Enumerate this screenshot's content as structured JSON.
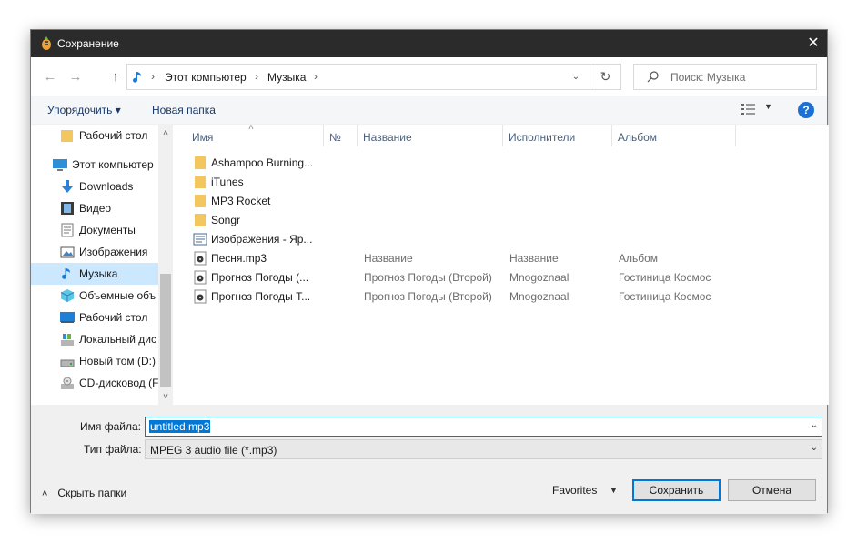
{
  "window": {
    "title": "Сохранение",
    "close_glyph": "✕"
  },
  "address": {
    "back_glyph": "←",
    "forward_glyph": "→",
    "up_glyph": "↑",
    "crumbs": [
      "Этот компьютер",
      "Музыка"
    ],
    "sep_glyph": "›",
    "dropdown_glyph": "⌄",
    "refresh_glyph": "↻",
    "search_placeholder": "Поиск: Музыка"
  },
  "toolbar": {
    "organize_label": "Упорядочить ▾",
    "new_folder_label": "Новая папка",
    "view_dd_glyph": "▼",
    "help_glyph": "?"
  },
  "navpane": {
    "items": [
      {
        "label": "Рабочий стол",
        "icon": "folder-icon"
      },
      {
        "label": "Этот компьютер",
        "icon": "computer-icon"
      },
      {
        "label": "Downloads",
        "icon": "download-icon"
      },
      {
        "label": "Видео",
        "icon": "video-icon"
      },
      {
        "label": "Документы",
        "icon": "document-icon"
      },
      {
        "label": "Изображения",
        "icon": "image-icon"
      },
      {
        "label": "Музыка",
        "icon": "music-icon",
        "selected": true
      },
      {
        "label": "Объемные объ",
        "icon": "3d-objects-icon"
      },
      {
        "label": "Рабочий стол",
        "icon": "desktop-icon"
      },
      {
        "label": "Локальный дис",
        "icon": "drive-icon"
      },
      {
        "label": "Новый том (D:)",
        "icon": "drive-icon"
      },
      {
        "label": "CD-дисковод (F",
        "icon": "cd-drive-icon"
      }
    ],
    "scroll_up_glyph": "˄",
    "scroll_down_glyph": "˅"
  },
  "columns": {
    "name": "Имя",
    "number": "№",
    "title": "Название",
    "artists": "Исполнители",
    "album": "Альбом",
    "sort_glyph": "˄"
  },
  "files": [
    {
      "name": "Ashampoo Burning...",
      "type": "folder",
      "title": "",
      "artist": "",
      "album": ""
    },
    {
      "name": "iTunes",
      "type": "folder",
      "title": "",
      "artist": "",
      "album": ""
    },
    {
      "name": "MP3 Rocket",
      "type": "folder",
      "title": "",
      "artist": "",
      "album": ""
    },
    {
      "name": "Songr",
      "type": "folder",
      "title": "",
      "artist": "",
      "album": ""
    },
    {
      "name": "Изображения - Яр...",
      "type": "shortcut",
      "title": "",
      "artist": "",
      "album": ""
    },
    {
      "name": "Песня.mp3",
      "type": "audio",
      "title": "Название",
      "artist": "Название",
      "album": "Альбом"
    },
    {
      "name": "Прогноз Погоды (...",
      "type": "audio",
      "title": "Прогноз Погоды (Второй)",
      "artist": "Mnogoznaal",
      "album": "Гостиница Космос"
    },
    {
      "name": "Прогноз Погоды Т...",
      "type": "audio",
      "title": "Прогноз Погоды (Второй)",
      "artist": "Mnogoznaal",
      "album": "Гостиница Космос"
    }
  ],
  "form": {
    "filename_label": "Имя файла:",
    "filename_value": "untitled.mp3",
    "filetype_label": "Тип файла:",
    "filetype_value": "MPEG 3 audio file (*.mp3)",
    "dd_glyph": "⌄"
  },
  "footer": {
    "hide_folders_chev": "˄",
    "hide_folders_label": "Скрыть папки",
    "favorites_label": "Favorites",
    "favorites_dd_glyph": "▼",
    "save_label": "Сохранить",
    "cancel_label": "Отмена"
  },
  "colors": {
    "accent": "#0078d7",
    "selected_bg": "#cce8ff",
    "titlebar": "#2b2b2b",
    "folder": "#f3c65f"
  }
}
